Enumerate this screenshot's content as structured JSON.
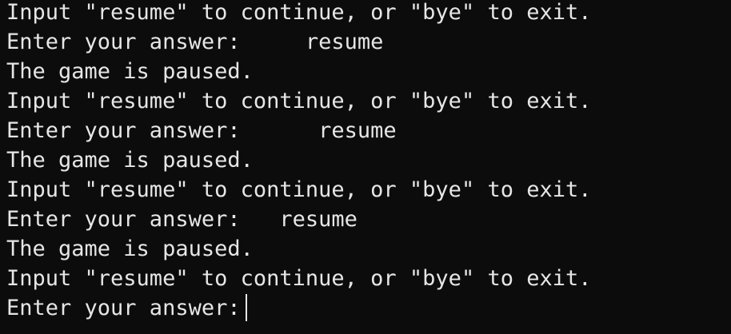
{
  "colors": {
    "background": "#0c0c0c",
    "text": "#e6e6e6"
  },
  "terminal": {
    "lines": [
      {
        "kind": "output",
        "text": "Input \"resume\" to continue, or \"bye\" to exit."
      },
      {
        "kind": "prompt",
        "label": "Enter your answer:",
        "input": "    resume"
      },
      {
        "kind": "output",
        "text": "The game is paused."
      },
      {
        "kind": "output",
        "text": "Input \"resume\" to continue, or \"bye\" to exit."
      },
      {
        "kind": "prompt",
        "label": "Enter your answer:",
        "input": "     resume"
      },
      {
        "kind": "output",
        "text": "The game is paused."
      },
      {
        "kind": "output",
        "text": "Input \"resume\" to continue, or \"bye\" to exit."
      },
      {
        "kind": "prompt",
        "label": "Enter your answer:",
        "input": "  resume"
      },
      {
        "kind": "output",
        "text": "The game is paused."
      },
      {
        "kind": "output",
        "text": "Input \"resume\" to continue, or \"bye\" to exit."
      }
    ],
    "active_prompt": {
      "label": "Enter your answer:",
      "input": ""
    }
  }
}
